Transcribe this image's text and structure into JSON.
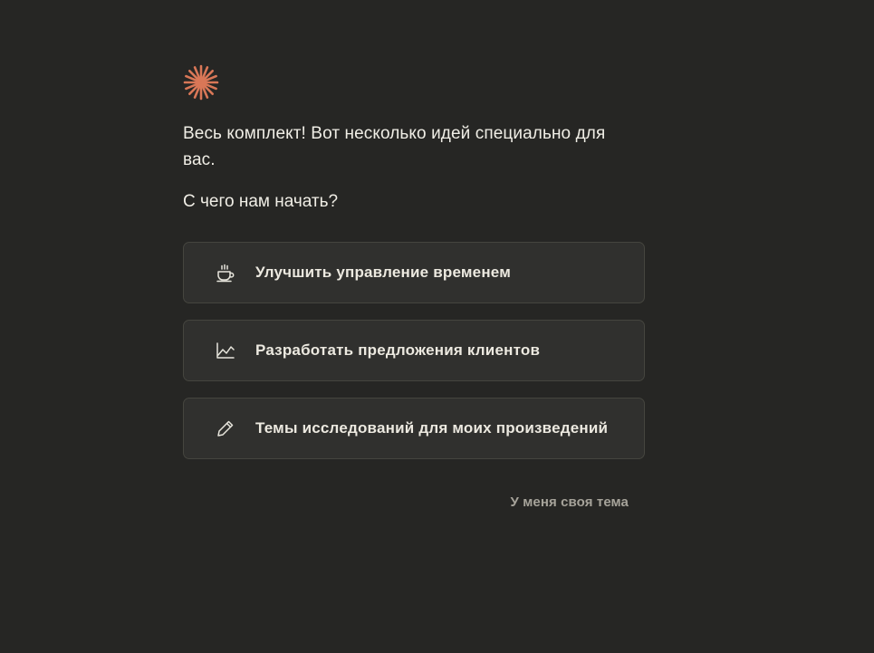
{
  "brand": {
    "logo_icon": "sparkle-asterisk-icon",
    "accent_color": "#d97757"
  },
  "intro": {
    "headline": "Весь комплект! Вот несколько идей специально для вас.",
    "question": "С чего нам начать?"
  },
  "options": [
    {
      "icon": "coffee-cup-icon",
      "label": "Улучшить управление временем"
    },
    {
      "icon": "line-chart-icon",
      "label": "Разработать предложения клиентов"
    },
    {
      "icon": "pencil-icon",
      "label": "Темы исследований для моих произведений"
    }
  ],
  "own_topic_link": "У меня своя тема"
}
